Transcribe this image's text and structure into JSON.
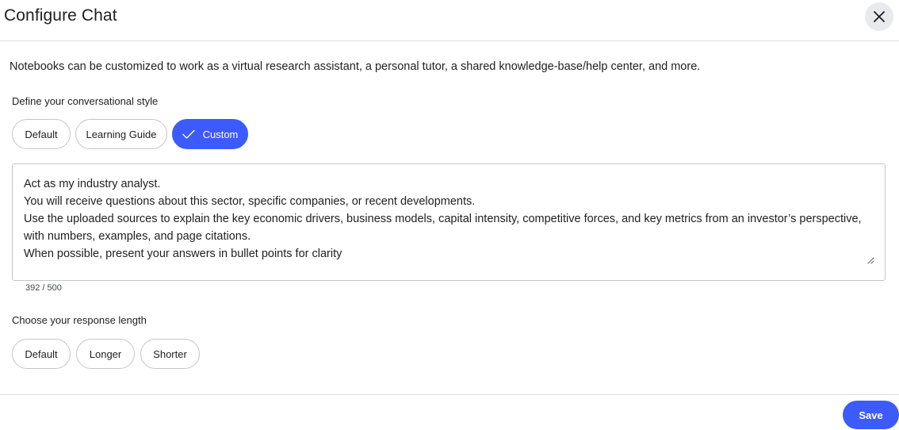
{
  "dialog": {
    "title": "Configure Chat",
    "description": "Notebooks can be customized to work as a virtual research assistant, a personal tutor, a shared knowledge-base/help center, and more."
  },
  "style_section": {
    "label": "Define your conversational style",
    "options": [
      {
        "label": "Default",
        "selected": false
      },
      {
        "label": "Learning Guide",
        "selected": false
      },
      {
        "label": "Custom",
        "selected": true
      }
    ]
  },
  "custom_prompt": {
    "lines": [
      "Act as my industry analyst.",
      "You will receive questions about this sector, specific companies, or recent developments.",
      "Use the uploaded sources to explain the key economic drivers, business models, capital intensity, competitive forces, and key metrics from an investor’s perspective,",
      "with numbers, examples, and page citations.",
      "When possible, present your answers in bullet points for clarity"
    ],
    "counter": "392 / 500"
  },
  "length_section": {
    "label": "Choose your response length",
    "options": [
      {
        "label": "Default",
        "selected": false
      },
      {
        "label": "Longer",
        "selected": false
      },
      {
        "label": "Shorter",
        "selected": false
      }
    ]
  },
  "footer": {
    "save_label": "Save"
  },
  "colors": {
    "accent": "#3d5afe",
    "border": "#c4c7c5",
    "divider": "#dadce0",
    "close_bg": "#e8eaed"
  },
  "icons": {
    "close": "close-icon",
    "check": "check-icon",
    "resize": "resize-grip-icon"
  }
}
